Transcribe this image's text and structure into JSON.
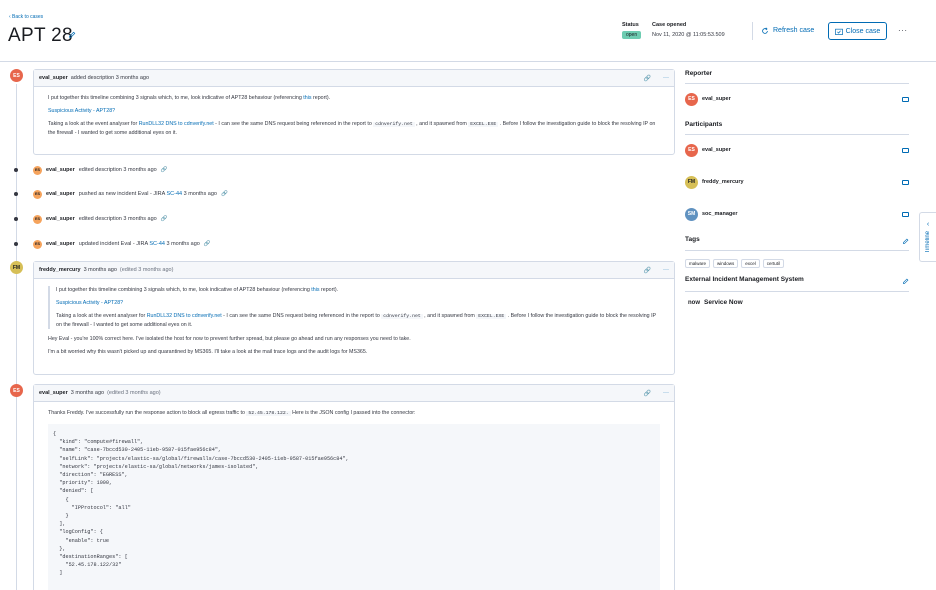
{
  "header": {
    "back_link": "‹ Back to cases",
    "title": "APT 28",
    "status_label": "Status",
    "status_value": "open",
    "opened_label": "Case opened",
    "opened_value": "Nov 11, 2020 @ 11:05:53.509",
    "refresh_label": "Refresh case",
    "close_label": "Close case",
    "more_label": "···"
  },
  "comments": {
    "c1": {
      "author": "eval_super",
      "meta": "added description 3 months ago",
      "p1_pre": "I put together this timeline combining 3 signals which, to me, look indicative of APT28 behaviour (referencing ",
      "p1_link": "this",
      "p1_post": " report).",
      "p2_link": "Suspicious Activity - APT28?",
      "p3_pre": "Taking a look at the event analyser for ",
      "p3_link": "RunDLL32 DNS to cdnverify.net",
      "p3_mid1": " - I can see the same DNS request being referenced in the report to ",
      "p3_code1": "cdnverify.net",
      "p3_mid2": " , and it spawned from ",
      "p3_code2": "EXCEL.EXE",
      "p3_post": " . Before I follow the investigation guide to block the resolving IP on the firewall - I wanted to get some additional eyes on it."
    },
    "c2": {
      "author": "freddy_mercury",
      "meta": "3 months ago",
      "edited": "(edited 3 months ago)",
      "p4": "Hey Eval - you're 100% correct here. I've isolated the host for now to prevent further spread, but please go ahead and run any responses you need to take.",
      "p5": "I'm a bit worried why this wasn't picked up and quarantined by MS365. I'll take a look at the mail trace logs and the audit logs for MS365."
    },
    "c3": {
      "author": "eval_super",
      "meta": "3 months ago",
      "edited": "(edited 3 months ago)",
      "p1_pre": "Thanks Freddy. I've successfully run the response action to block all egress traffic to ",
      "p1_code": "52.45.178.122.",
      "p1_post": "  Here is the JSON config I passed into the connector:",
      "code": "{\n  \"kind\": \"compute#firewall\",\n  \"name\": \"case-7bccd530-2405-11eb-9587-015fae956c84\",\n  \"selfLink\": \"projects/elastic-sa/global/firewalls/case-7bccd530-2405-11eb-9587-015fae956c84\",\n  \"network\": \"projects/elastic-sa/global/networks/james-isolated\",\n  \"direction\": \"EGRESS\",\n  \"priority\": 1000,\n  \"denied\": [\n    {\n      \"IPProtocol\": \"all\"\n    }\n  ],\n  \"logConfig\": {\n    \"enable\": true\n  },\n  \"destinationRanges\": [\n    \"52.45.178.122/32\"\n  ]"
    }
  },
  "actions": [
    {
      "author": "eval_super",
      "text": "edited description 3 months ago",
      "link": ""
    },
    {
      "author": "eval_super",
      "text_pre": "pushed as new incident Eval - JIRA ",
      "link": "SC-44",
      "text_post": " 3 months ago"
    },
    {
      "author": "eval_super",
      "text": "edited description 3 months ago",
      "link": ""
    },
    {
      "author": "eval_super",
      "text_pre": "updated incident Eval - JIRA ",
      "link": "SC-44",
      "text_post": " 3 months ago"
    }
  ],
  "avatars": {
    "es": "ES",
    "fm": "FM",
    "sm": "SM"
  },
  "sidebar": {
    "reporter_title": "Reporter",
    "reporter": "eval_super",
    "participants_title": "Participants",
    "participants": [
      "eval_super",
      "freddy_mercury",
      "soc_manager"
    ],
    "tags_title": "Tags",
    "tags": [
      "malware",
      "windows",
      "excel",
      "certutil"
    ],
    "ext_title": "External Incident Management System",
    "ext_logo": "now",
    "ext_value": "Service Now"
  },
  "timeline_tab": "Timeline",
  "colors": {
    "accent": "#006bb4",
    "status_open": "#6dccb1",
    "border": "#d3dae6"
  }
}
